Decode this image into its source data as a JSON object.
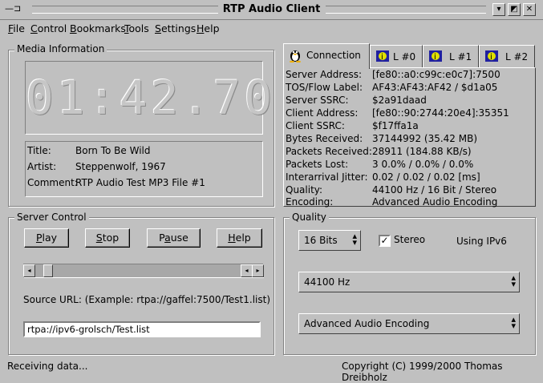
{
  "window": {
    "title": "RTP Audio Client"
  },
  "menu": [
    {
      "label": "File",
      "u": "F",
      "rest": "ile"
    },
    {
      "label": "Control",
      "u": "C",
      "rest": "ontrol"
    },
    {
      "label": "Bookmarks",
      "u": "B",
      "rest": "ookmarks"
    },
    {
      "label": "Tools",
      "u": "T",
      "rest": "ools"
    },
    {
      "label": "Settings",
      "u": "S",
      "rest": "ettings"
    },
    {
      "label": "Help",
      "u": "H",
      "rest": "elp"
    }
  ],
  "media": {
    "group_title": "Media Information",
    "time": "01:42.70",
    "rows": [
      {
        "label": "Title:",
        "value": "Born To Be Wild"
      },
      {
        "label": "Artist:",
        "value": "Steppenwolf, 1967"
      },
      {
        "label": "Comment:",
        "value": "RTP Audio Test MP3 File #1"
      }
    ]
  },
  "tabs": [
    {
      "label": "Connection",
      "icon": "tux-penguin-icon",
      "active": true
    },
    {
      "label": "L #0",
      "icon": "globe-icon",
      "active": false
    },
    {
      "label": "L #1",
      "icon": "globe-icon",
      "active": false
    },
    {
      "label": "L #2",
      "icon": "globe-icon",
      "active": false
    }
  ],
  "connection": [
    {
      "label": "Server Address:",
      "value": "[fe80::a0:c99c:e0c7]:7500"
    },
    {
      "label": "TOS/Flow Label:",
      "value": "AF43:AF43:AF42 / $d1a05"
    },
    {
      "label": "Server SSRC:",
      "value": "$2a91daad"
    },
    {
      "label": "Client Address:",
      "value": "[fe80::90:2744:20e4]:35351"
    },
    {
      "label": "Client SSRC:",
      "value": "$f17ffa1a"
    },
    {
      "label": "Bytes Received:",
      "value": "37144992 (35.42 MB)"
    },
    {
      "label": "Packets Received:",
      "value": "28911 (184.88 KB/s)"
    },
    {
      "label": "Packets Lost:",
      "value": "3 0.0% / 0.0% / 0.0%"
    },
    {
      "label": "Interarrival Jitter:",
      "value": "0.02 / 0.02 / 0.02 [ms]"
    },
    {
      "label": "Quality:",
      "value": "44100 Hz / 16 Bit / Stereo"
    },
    {
      "label": "Encoding:",
      "value": "Advanced Audio Encoding"
    }
  ],
  "server_control": {
    "group_title": "Server Control",
    "buttons": {
      "play": {
        "u": "P",
        "rest": "lay"
      },
      "stop": {
        "u": "S",
        "rest": "top"
      },
      "pause": {
        "pre": "P",
        "u": "a",
        "rest": "use"
      },
      "help": {
        "u": "H",
        "rest": "elp"
      }
    },
    "position_fraction": 0.05,
    "source_hint": "Source URL: (Example: rtpa://gaffel:7500/Test1.list)",
    "url_value": "rtpa://ipv6-grolsch/Test.list"
  },
  "quality": {
    "group_title": "Quality",
    "bits": "16 Bits",
    "stereo_label": "Stereo",
    "stereo_checked": true,
    "ipv6_label": "Using IPv6",
    "rate": "44100 Hz",
    "encoding": "Advanced Audio Encoding"
  },
  "status": {
    "left": "Receiving data...",
    "right": "Copyright (C) 1999/2000 Thomas Dreibholz"
  }
}
